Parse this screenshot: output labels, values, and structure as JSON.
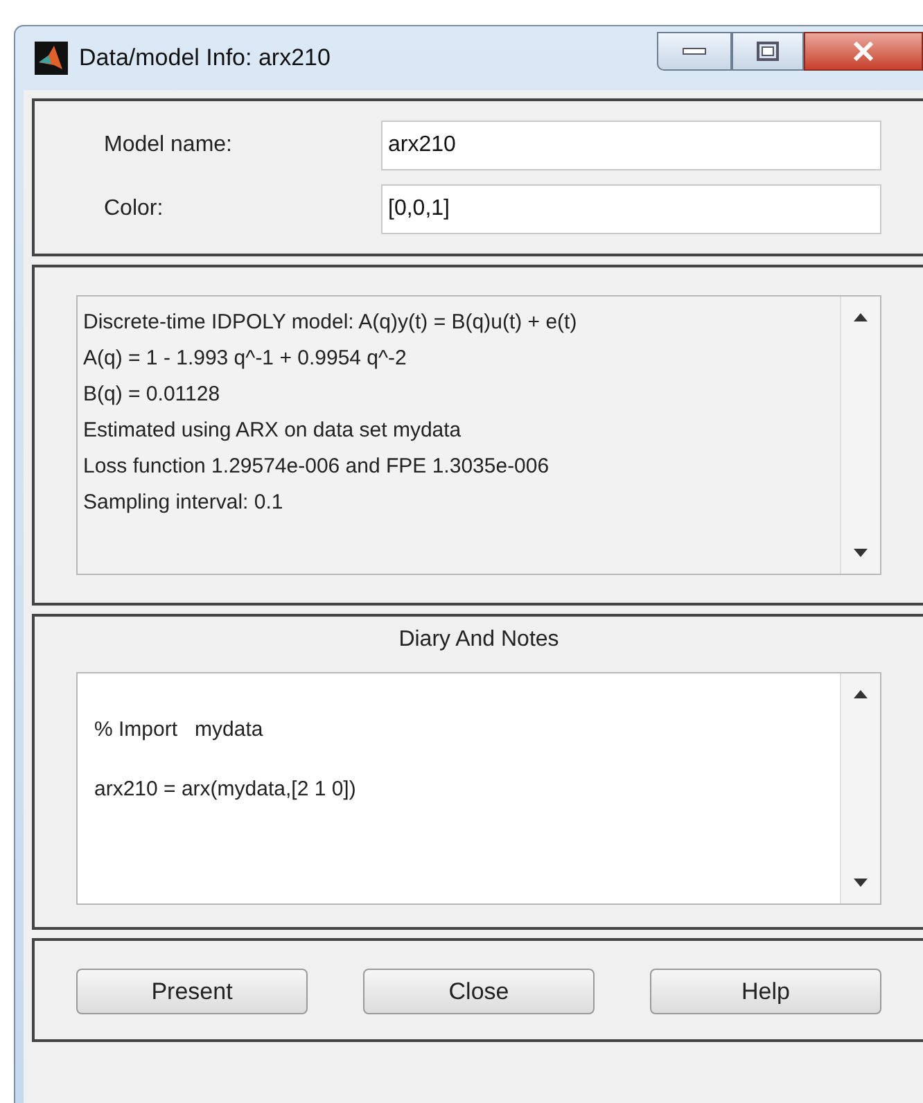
{
  "window": {
    "title": "Data/model Info: arx210"
  },
  "fields": [
    {
      "label": "Model name:",
      "value": "arx210"
    },
    {
      "label": "Color:",
      "value": "[0,0,1]"
    }
  ],
  "info": {
    "lines": [
      "Discrete-time IDPOLY model: A(q)y(t) = B(q)u(t) + e(t)",
      "A(q) = 1 - 1.993 q^-1 + 0.9954 q^-2",
      "B(q) = 0.01128",
      "Estimated using ARX on data set mydata",
      "Loss function 1.29574e-006 and FPE 1.3035e-006",
      "Sampling interval: 0.1"
    ]
  },
  "diary": {
    "title": "Diary And Notes",
    "lines": [
      "% Import   mydata",
      "arx210 = arx(mydata,[2 1 0])"
    ]
  },
  "buttons": [
    "Present",
    "Close",
    "Help"
  ]
}
